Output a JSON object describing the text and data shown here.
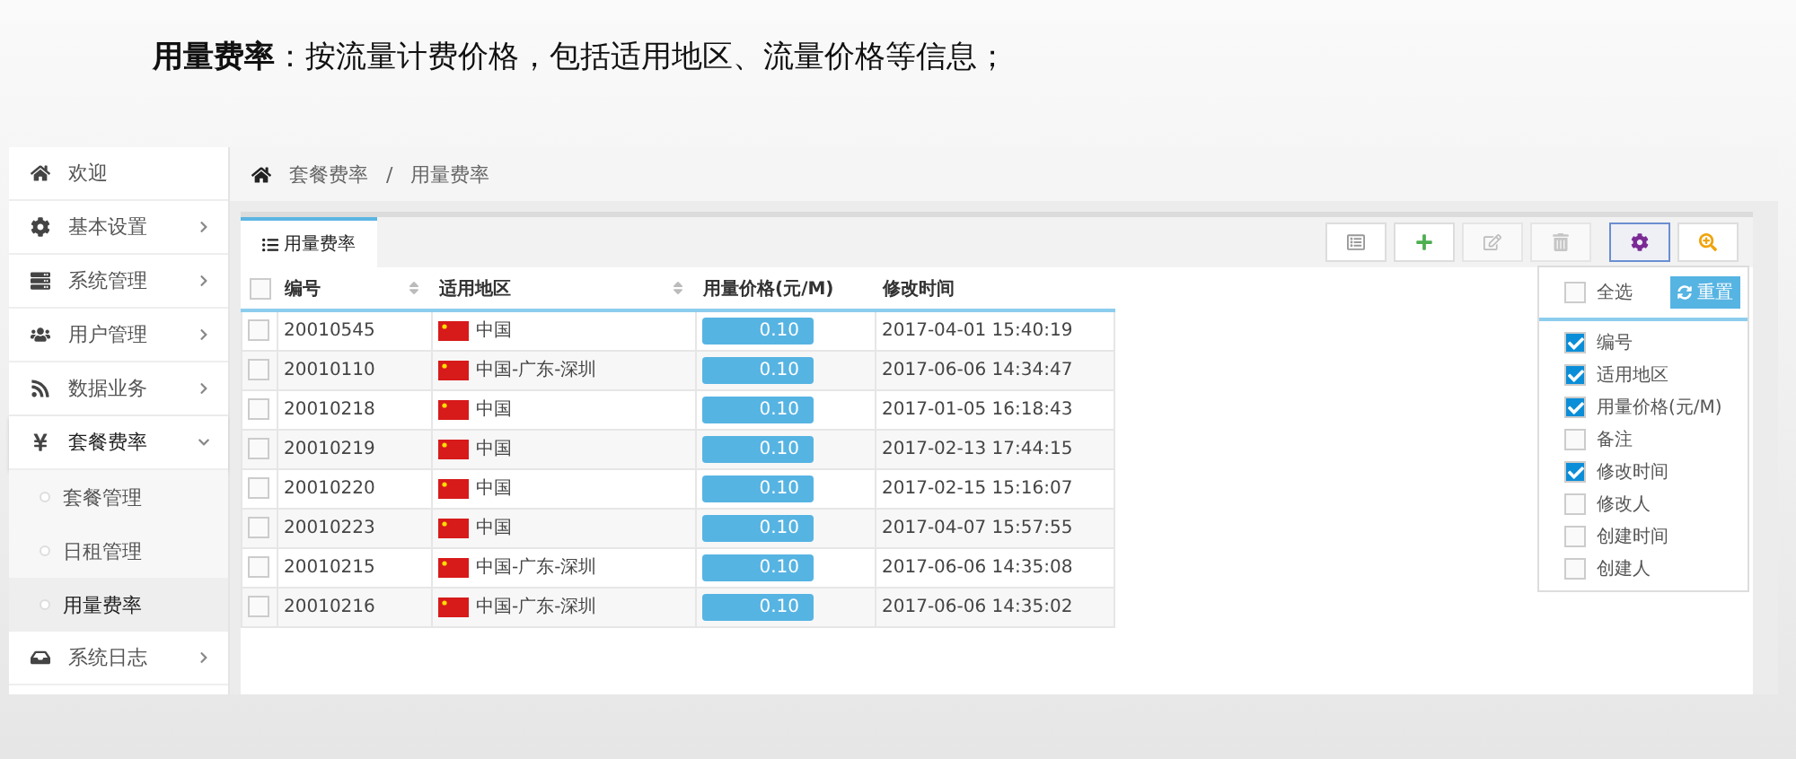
{
  "heading": {
    "title": "用量费率",
    "text": "：按流量计费价格，包括适用地区、流量价格等信息；"
  },
  "sidebar": {
    "items": [
      {
        "label": "欢迎",
        "kind": "home",
        "has_arrow": false,
        "expanded": false
      },
      {
        "label": "基本设置",
        "kind": "gear",
        "has_arrow": true,
        "expanded": false
      },
      {
        "label": "系统管理",
        "kind": "server",
        "has_arrow": true,
        "expanded": false
      },
      {
        "label": "用户管理",
        "kind": "users",
        "has_arrow": true,
        "expanded": false
      },
      {
        "label": "数据业务",
        "kind": "rss",
        "has_arrow": true,
        "expanded": false
      },
      {
        "label": "套餐费率",
        "kind": "yen",
        "has_arrow": true,
        "expanded": true,
        "children": [
          {
            "label": "套餐管理",
            "selected": false
          },
          {
            "label": "日租管理",
            "selected": false
          },
          {
            "label": "用量费率",
            "selected": true
          }
        ]
      },
      {
        "label": "系统日志",
        "kind": "inbox",
        "has_arrow": true,
        "expanded": false
      }
    ]
  },
  "breadcrumb": {
    "items": [
      "套餐费率",
      "用量费率"
    ],
    "separator": "/"
  },
  "tab": {
    "label": "用量费率",
    "selected": true
  },
  "toolbar": [
    {
      "kind": "list",
      "disabled": false,
      "active": false
    },
    {
      "kind": "plus",
      "disabled": false,
      "active": false
    },
    {
      "kind": "edit",
      "disabled": true,
      "active": false
    },
    {
      "kind": "trash",
      "disabled": true,
      "active": false
    },
    {
      "kind": "gear",
      "disabled": false,
      "active": true
    },
    {
      "kind": "zoom",
      "disabled": false,
      "active": false
    }
  ],
  "table": {
    "all_checked": false,
    "columns": [
      {
        "label": "编号",
        "sortable": true
      },
      {
        "label": "适用地区",
        "sortable": true
      },
      {
        "label": "用量价格(元/M)",
        "sortable": false
      },
      {
        "label": "修改时间",
        "sortable": false
      }
    ],
    "rows": [
      {
        "id": "20010545",
        "region": "中国",
        "price": "0.10",
        "time": "2017-04-01 15:40:19",
        "checked": false
      },
      {
        "id": "20010110",
        "region": "中国-广东-深圳",
        "price": "0.10",
        "time": "2017-06-06 14:34:47",
        "checked": false
      },
      {
        "id": "20010218",
        "region": "中国",
        "price": "0.10",
        "time": "2017-01-05 16:18:43",
        "checked": false
      },
      {
        "id": "20010219",
        "region": "中国",
        "price": "0.10",
        "time": "2017-02-13 17:44:15",
        "checked": false
      },
      {
        "id": "20010220",
        "region": "中国",
        "price": "0.10",
        "time": "2017-02-15 15:16:07",
        "checked": false
      },
      {
        "id": "20010223",
        "region": "中国",
        "price": "0.10",
        "time": "2017-04-07 15:57:55",
        "checked": false
      },
      {
        "id": "20010215",
        "region": "中国-广东-深圳",
        "price": "0.10",
        "time": "2017-06-06 14:35:08",
        "checked": false
      },
      {
        "id": "20010216",
        "region": "中国-广东-深圳",
        "price": "0.10",
        "time": "2017-06-06 14:35:02",
        "checked": false
      }
    ]
  },
  "column_menu": {
    "select_all": {
      "label": "全选",
      "checked": false
    },
    "reset": "重置",
    "options": [
      {
        "label": "编号",
        "checked": true
      },
      {
        "label": "适用地区",
        "checked": true
      },
      {
        "label": "用量价格(元/M)",
        "checked": true
      },
      {
        "label": "备注",
        "checked": false
      },
      {
        "label": "修改时间",
        "checked": true
      },
      {
        "label": "修改人",
        "checked": false
      },
      {
        "label": "创建时间",
        "checked": false
      },
      {
        "label": "创建人",
        "checked": false
      }
    ]
  }
}
